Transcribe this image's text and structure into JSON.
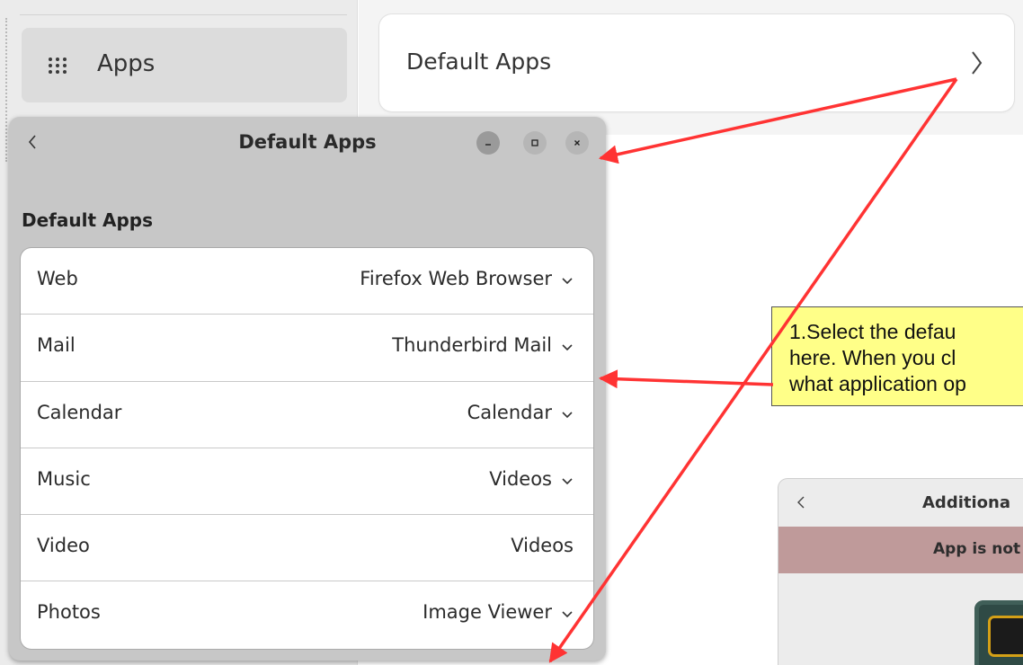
{
  "sidebar": {
    "items": [
      {
        "label": "Apps",
        "icon": "app-grid-icon"
      }
    ]
  },
  "main": {
    "rows": [
      {
        "label": "Default Apps",
        "icon": "chevron-right-icon"
      }
    ]
  },
  "dialog": {
    "title": "Default Apps",
    "section_heading": "Default Apps",
    "rows": [
      {
        "label": "Web",
        "value": "Firefox Web Browser"
      },
      {
        "label": "Mail",
        "value": "Thunderbird Mail"
      },
      {
        "label": "Calendar",
        "value": "Calendar"
      },
      {
        "label": "Music",
        "value": "Videos"
      },
      {
        "label": "Video",
        "value": "Videos"
      },
      {
        "label": "Photos",
        "value": "Image Viewer"
      }
    ]
  },
  "callout": {
    "lines": [
      "1.Select the defau",
      "here. When you cl",
      "what application op"
    ],
    "background": "#ffff88"
  },
  "additional_window": {
    "title": "Additiona",
    "banner": "App is not s",
    "banner_color": "#bf9a9a"
  },
  "colors": {
    "arrow": "#ff3333"
  }
}
